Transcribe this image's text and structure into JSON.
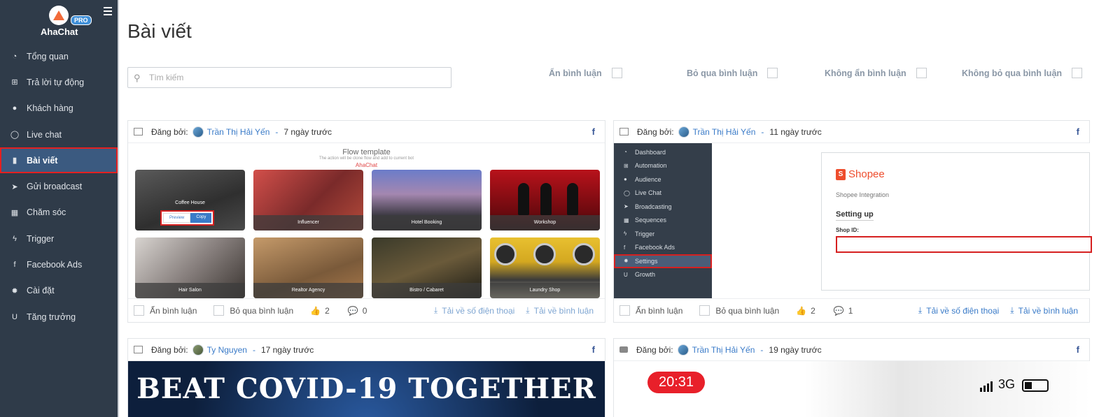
{
  "sidebar": {
    "brand": "AhaChat",
    "pro": "PRO",
    "items": [
      {
        "label": "Tổng quan",
        "icon": "dashboard-icon",
        "glyph": "◔"
      },
      {
        "label": "Trả lời tự động",
        "icon": "sitemap-icon",
        "glyph": "⊞"
      },
      {
        "label": "Khách hàng",
        "icon": "user-icon",
        "glyph": "●"
      },
      {
        "label": "Live chat",
        "icon": "chat-icon",
        "glyph": "◯"
      },
      {
        "label": "Bài viết",
        "icon": "book-icon",
        "glyph": "▮"
      },
      {
        "label": "Gửi broadcast",
        "icon": "paper-plane-icon",
        "glyph": "➤"
      },
      {
        "label": "Chăm sóc",
        "icon": "calendar-icon",
        "glyph": "▦"
      },
      {
        "label": "Trigger",
        "icon": "bolt-icon",
        "glyph": "ϟ"
      },
      {
        "label": "Facebook Ads",
        "icon": "facebook-square-icon",
        "glyph": "f"
      },
      {
        "label": "Cài đặt",
        "icon": "gear-icon",
        "glyph": "✹"
      },
      {
        "label": "Tăng trưởng",
        "icon": "magnet-icon",
        "glyph": "U"
      }
    ],
    "active_index": 4
  },
  "main": {
    "title": "Bài viết",
    "search_placeholder": "Tìm kiếm",
    "filters": [
      "Ẩn bình luận",
      "Bỏ qua bình luận",
      "Không ẩn bình luận",
      "Không bỏ qua bình luận"
    ]
  },
  "posts": [
    {
      "posted_by": "Đăng bởi:",
      "author": "Trần Thị Hải Yến",
      "sep": "-",
      "time": "7 ngày trước",
      "likes": "2",
      "comments": "0",
      "hide_label": "Ẩn bình luận",
      "skip_label": "Bỏ qua bình luận",
      "dl_phone": "Tải về số điện thoại",
      "dl_comments": "Tải về bình luận",
      "flow": {
        "title": "Flow template",
        "subtitle": "The action will be clone flow and add to current bot",
        "brand": "AhaChat",
        "tiles": [
          "Coffee House",
          "Influencer",
          "Hotel Booking",
          "Workshop",
          "Hair Salon",
          "Realtor Agency",
          "Bistro / Cabaret",
          "Laundry Shop"
        ],
        "preview": "Preview",
        "copy": "Copy"
      }
    },
    {
      "posted_by": "Đăng bởi:",
      "author": "Trần Thị Hải Yến",
      "sep": "-",
      "time": "11 ngày trước",
      "likes": "2",
      "comments": "1",
      "hide_label": "Ẩn bình luận",
      "skip_label": "Bỏ qua bình luận",
      "dl_phone": "Tải về số điện thoại",
      "dl_comments": "Tải về bình luận",
      "shot": {
        "menu": [
          "Dashboard",
          "Automation",
          "Audience",
          "Live Chat",
          "Broadcasting",
          "Sequences",
          "Trigger",
          "Facebook Ads",
          "Settings",
          "Growth"
        ],
        "menu_glyphs": [
          "◔",
          "⊞",
          "●",
          "◯",
          "➤",
          "▦",
          "ϟ",
          "f",
          "✹",
          "U"
        ],
        "shopee": "Shopee",
        "integration": "Shopee Integration",
        "setting_up": "Setting up",
        "shop_id": "Shop ID:"
      }
    },
    {
      "posted_by": "Đăng bởi:",
      "author": "Ty Nguyen",
      "sep": "-",
      "time": "17 ngày trước",
      "banner": "BEAT COVID-19 TOGETHER"
    },
    {
      "posted_by": "Đăng bởi:",
      "author": "Trần Thị Hải Yến",
      "sep": "-",
      "time": "19 ngày trước",
      "clock": "20:31",
      "network": "3G"
    }
  ],
  "colors": {
    "sidebar": "#2f3b49",
    "active": "#3b5a80",
    "link": "#3a7bc8",
    "highlight": "#e52020"
  }
}
